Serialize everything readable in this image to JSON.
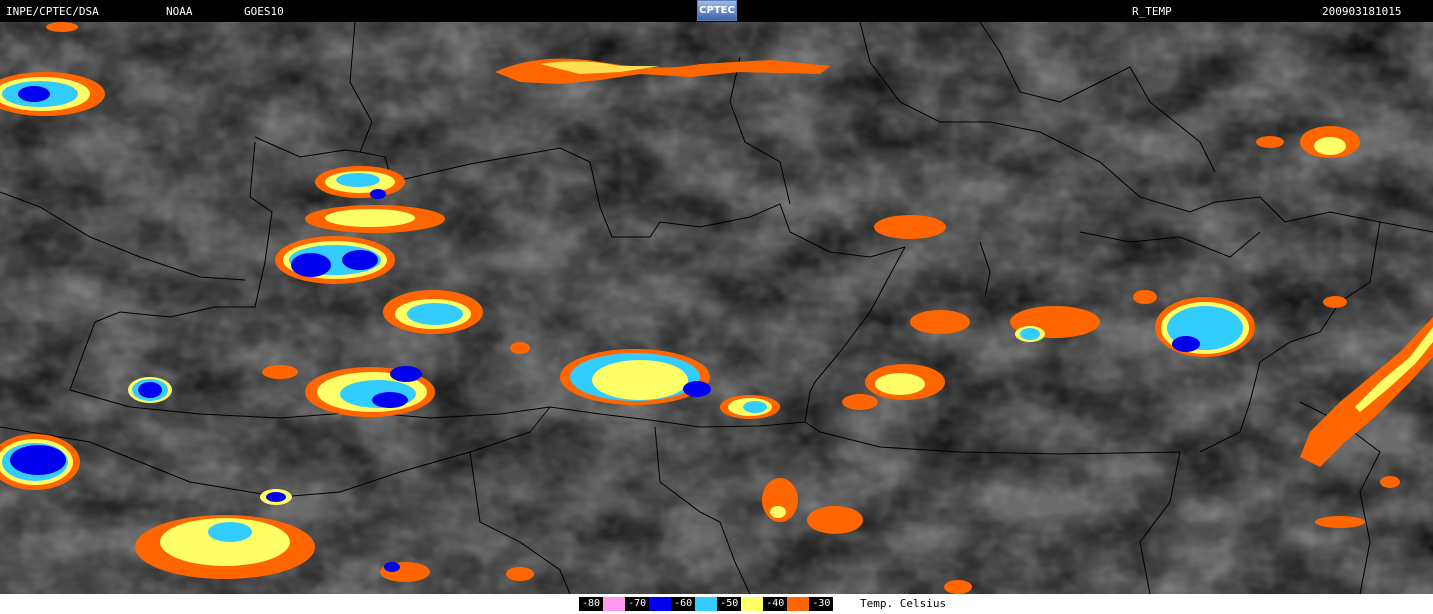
{
  "header": {
    "agency": "INPE/CPTEC/DSA",
    "source": "NOAA",
    "satellite": "GOES10",
    "logo_text": "CPTEC",
    "product": "R_TEMP",
    "timestamp": "200903181015"
  },
  "legend": {
    "items": [
      {
        "label": "-80",
        "color": "#ff99ee"
      },
      {
        "label": "-70",
        "color": "#0000ee"
      },
      {
        "label": "-60",
        "color": "#33ccff"
      },
      {
        "label": "-50",
        "color": "#ffff66"
      },
      {
        "label": "-40",
        "color": "#ff6600"
      },
      {
        "label": "-30",
        "color": null
      }
    ],
    "unit": "Temp. Celsius"
  },
  "colors": {
    "cloud_base": "#6e6e6e",
    "border": "#000000"
  }
}
